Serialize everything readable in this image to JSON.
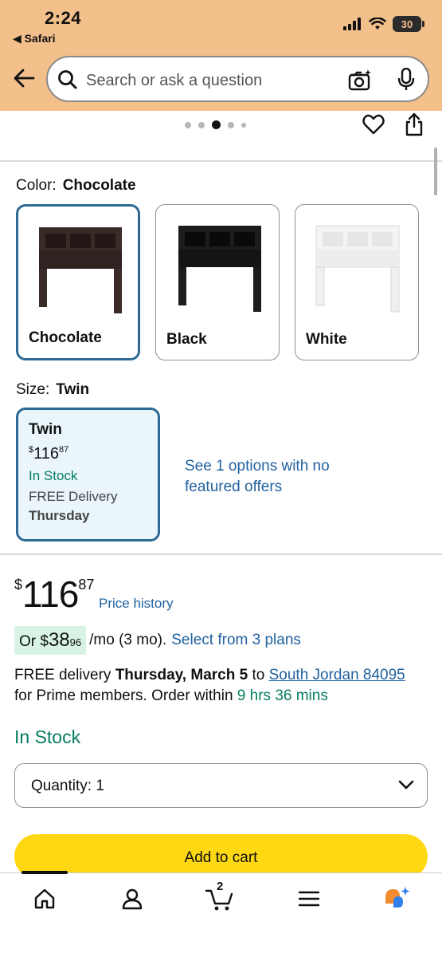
{
  "status_bar": {
    "time": "2:24",
    "back_app": "◀ Safari",
    "battery": "30"
  },
  "search": {
    "placeholder": "Search or ask a question"
  },
  "carousel": {
    "dots": 5,
    "active_index": 2
  },
  "color": {
    "label": "Color:",
    "selected": "Chocolate",
    "options": [
      {
        "label": "Chocolate",
        "shade": "#3a2a28"
      },
      {
        "label": "Black",
        "shade": "#1c1c1c"
      },
      {
        "label": "White",
        "shade": "#f4f4f4"
      }
    ]
  },
  "size": {
    "label": "Size:",
    "selected": "Twin",
    "card": {
      "title": "Twin",
      "price_symbol": "$",
      "price_whole": "116",
      "price_fraction": "87",
      "stock": "In Stock",
      "delivery": "FREE Delivery",
      "delivery_day": "Thursday"
    },
    "see_options": "See 1 options with no featured offers"
  },
  "price": {
    "symbol": "$",
    "whole": "116",
    "fraction": "87",
    "history_link": "Price history"
  },
  "plan": {
    "prefix": "Or $",
    "amount": "38",
    "cents": "96",
    "per": "/mo (3 mo).",
    "link": "Select from 3 plans"
  },
  "delivery": {
    "free_delivery": "FREE delivery",
    "date": "Thursday, March 5",
    "to": "to",
    "location": "South Jordan 84095",
    "prime_text": "for Prime members. Order within",
    "countdown": "9 hrs 36 mins"
  },
  "stock": "In Stock",
  "quantity": {
    "label": "Quantity:",
    "value": "1"
  },
  "add_to_cart": "Add to cart",
  "tabbar": {
    "cart_count": "2"
  },
  "colors": {
    "header_bg": "#f3c08b",
    "link_blue": "#2162a1",
    "stock_green": "#067d62",
    "selected_border": "#2f6a96",
    "cart_button": "#ffd814"
  }
}
